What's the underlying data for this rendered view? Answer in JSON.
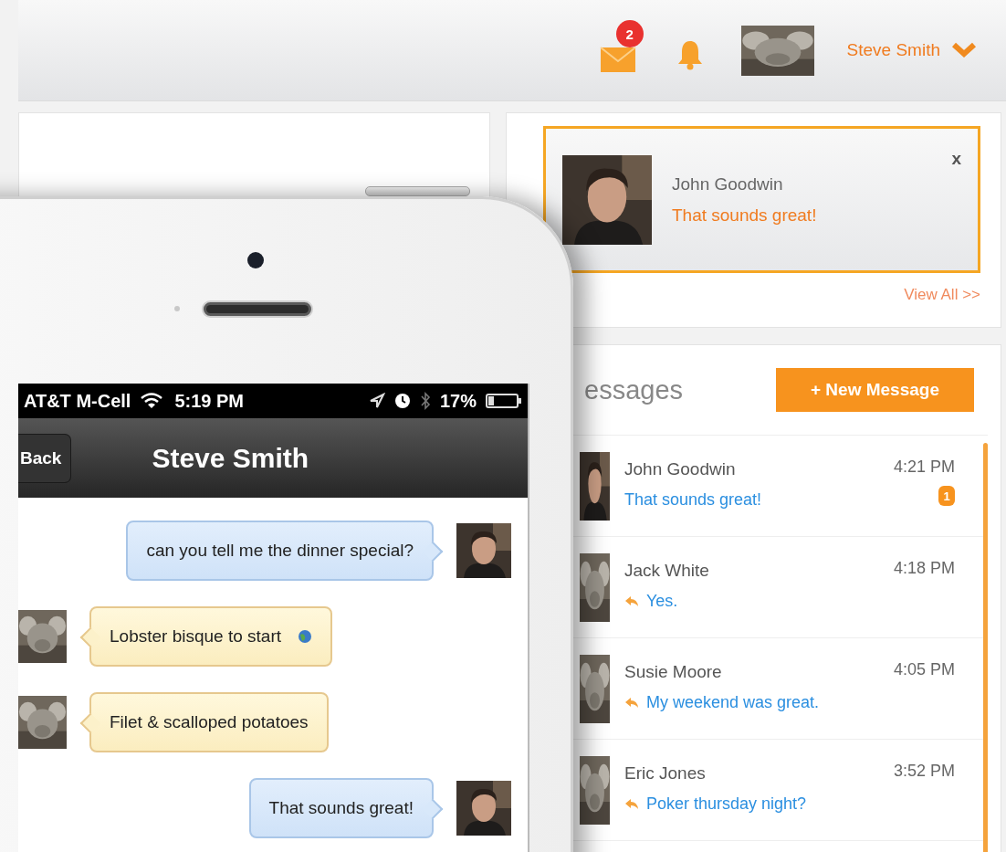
{
  "header": {
    "mail_badge": "2",
    "user_name": "Steve Smith"
  },
  "notification": {
    "name": "John Goodwin",
    "message": "That sounds great!",
    "close": "x",
    "link": "View All >>"
  },
  "messages_panel": {
    "title": "essages",
    "new_button": "+ New Message",
    "conversations": [
      {
        "name": "John Goodwin",
        "time": "4:21 PM",
        "message": "That sounds great!",
        "replied": false,
        "unread": "1"
      },
      {
        "name": "Jack White",
        "time": "4:18 PM",
        "message": "Yes.",
        "replied": true
      },
      {
        "name": "Susie Moore",
        "time": "4:05 PM",
        "message": "My weekend was great.",
        "replied": true
      },
      {
        "name": "Eric Jones",
        "time": "3:52 PM",
        "message": "Poker thursday night?",
        "replied": true
      }
    ]
  },
  "phone": {
    "carrier": "AT&T M-Cell",
    "time": "5:19 PM",
    "battery": "17%",
    "back": "Back",
    "title": "Steve Smith",
    "chat": [
      {
        "kind": "sent",
        "text": "can you tell me the dinner special?",
        "marked": false
      },
      {
        "kind": "received",
        "text": "Lobster bisque to start",
        "marked": true
      },
      {
        "kind": "received",
        "text": "Filet & scalloped potatoes",
        "marked": false
      },
      {
        "kind": "sent",
        "text": "That sounds great!",
        "marked": false
      }
    ]
  }
}
